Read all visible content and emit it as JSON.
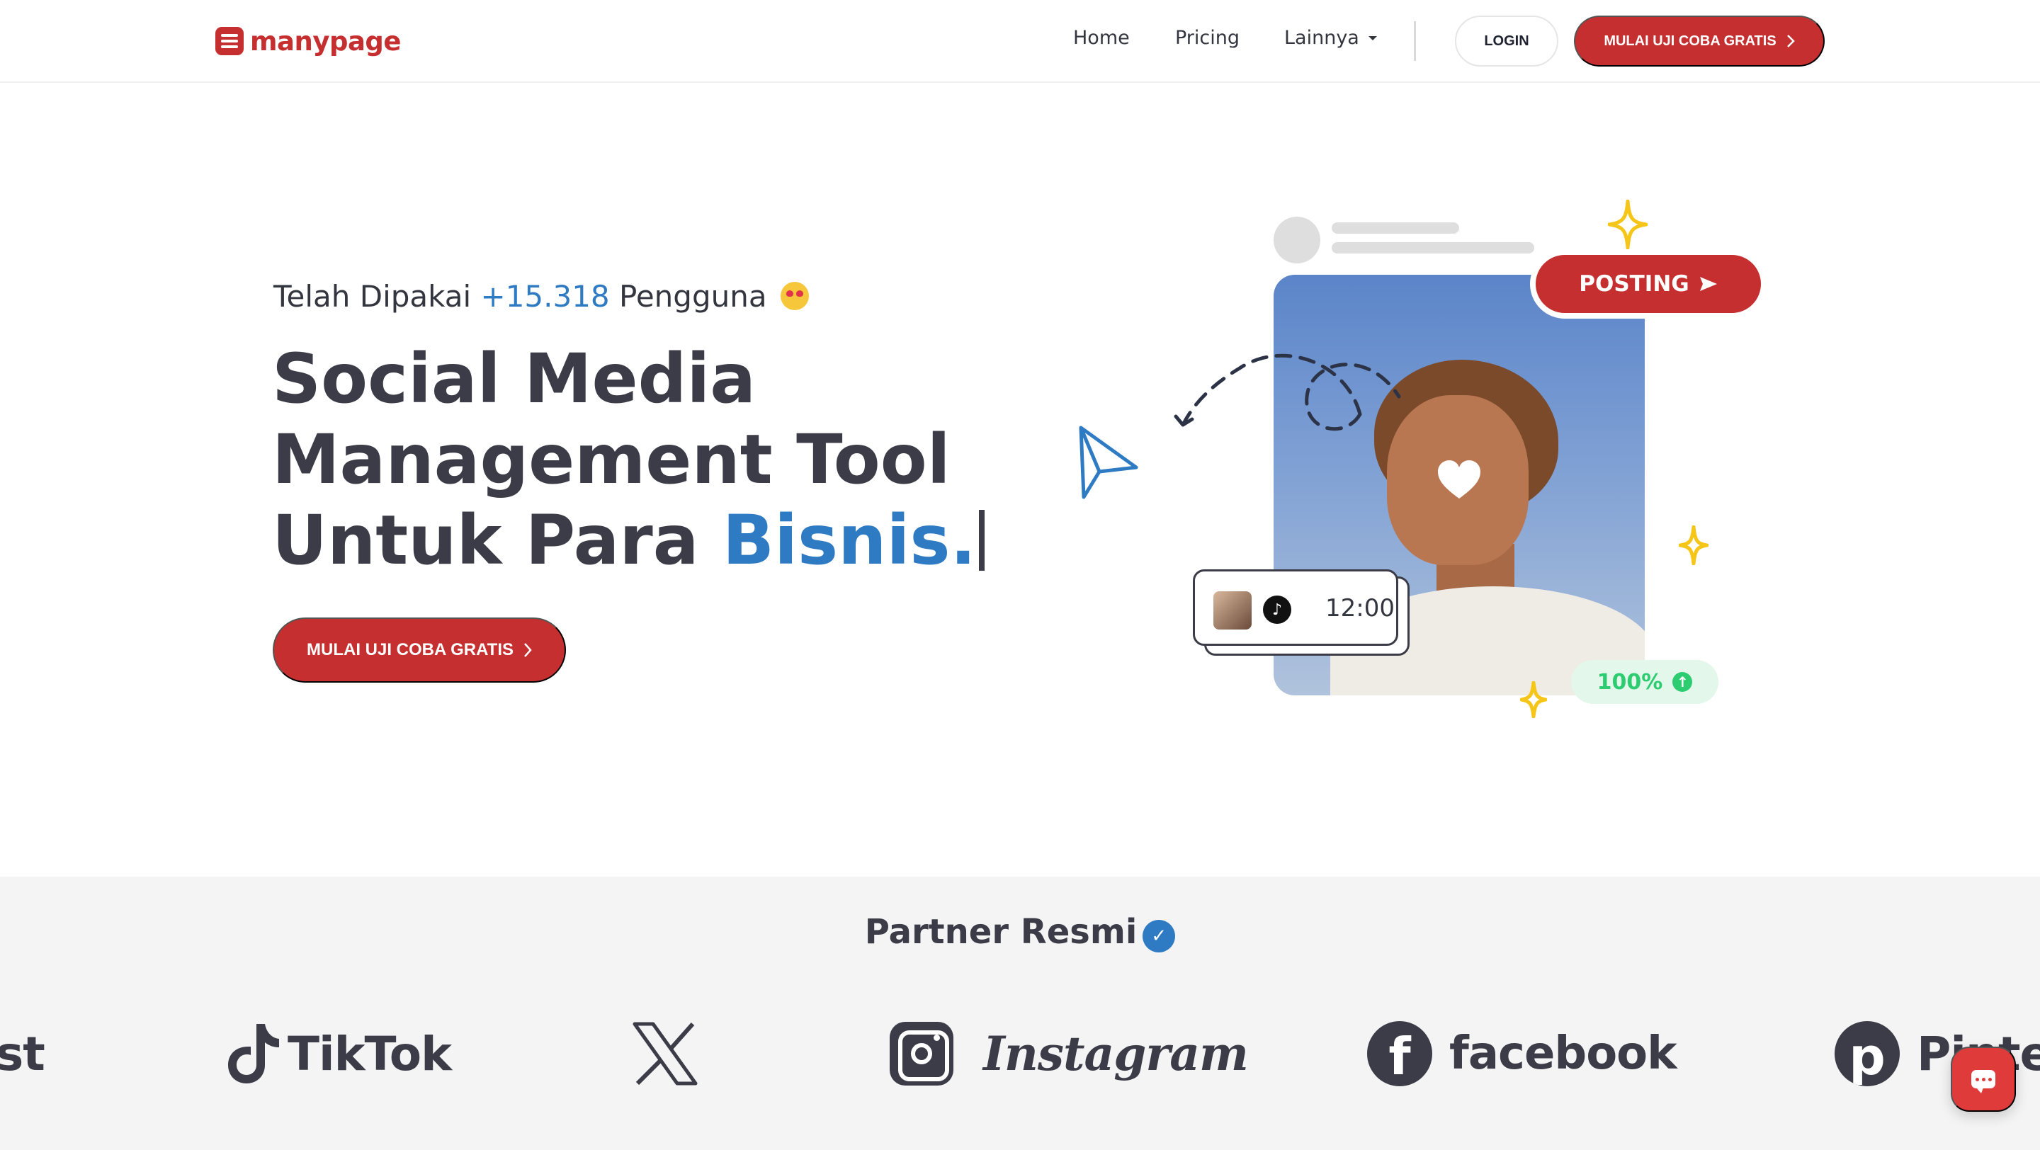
{
  "brand": {
    "name": "manypage",
    "logo_icon": "manypage-logo-icon"
  },
  "nav": {
    "links": [
      "Home",
      "Pricing",
      "Lainnya"
    ],
    "more_icon": "caret-down-icon",
    "login_label": "LOGIN",
    "cta_label": "MULAI UJI COBA GRATIS"
  },
  "hero": {
    "used_prefix": "Telah Dipakai",
    "used_count": "+15.318",
    "used_suffix": "Pengguna",
    "emoji": "heart-eyes-emoji",
    "title_line1": "Social Media",
    "title_line2": "Management Tool",
    "title_line3_prefix": "Untuk Para",
    "title_line3_accent": "Bisnis.",
    "cta_label": "MULAI UJI COBA GRATIS"
  },
  "illustration": {
    "posting_label": "POSTING",
    "schedule_time": "12:00",
    "progress": "100%"
  },
  "partners": {
    "title": "Partner Resmi",
    "logos": [
      "st",
      "TikTok",
      "X",
      "Instagram",
      "facebook",
      "Pinterest"
    ]
  },
  "colors": {
    "brand_red": "#c62f2f",
    "accent_blue": "#2e7bc4",
    "success_green": "#2ecc71",
    "sparkle_yellow": "#f5c518"
  }
}
